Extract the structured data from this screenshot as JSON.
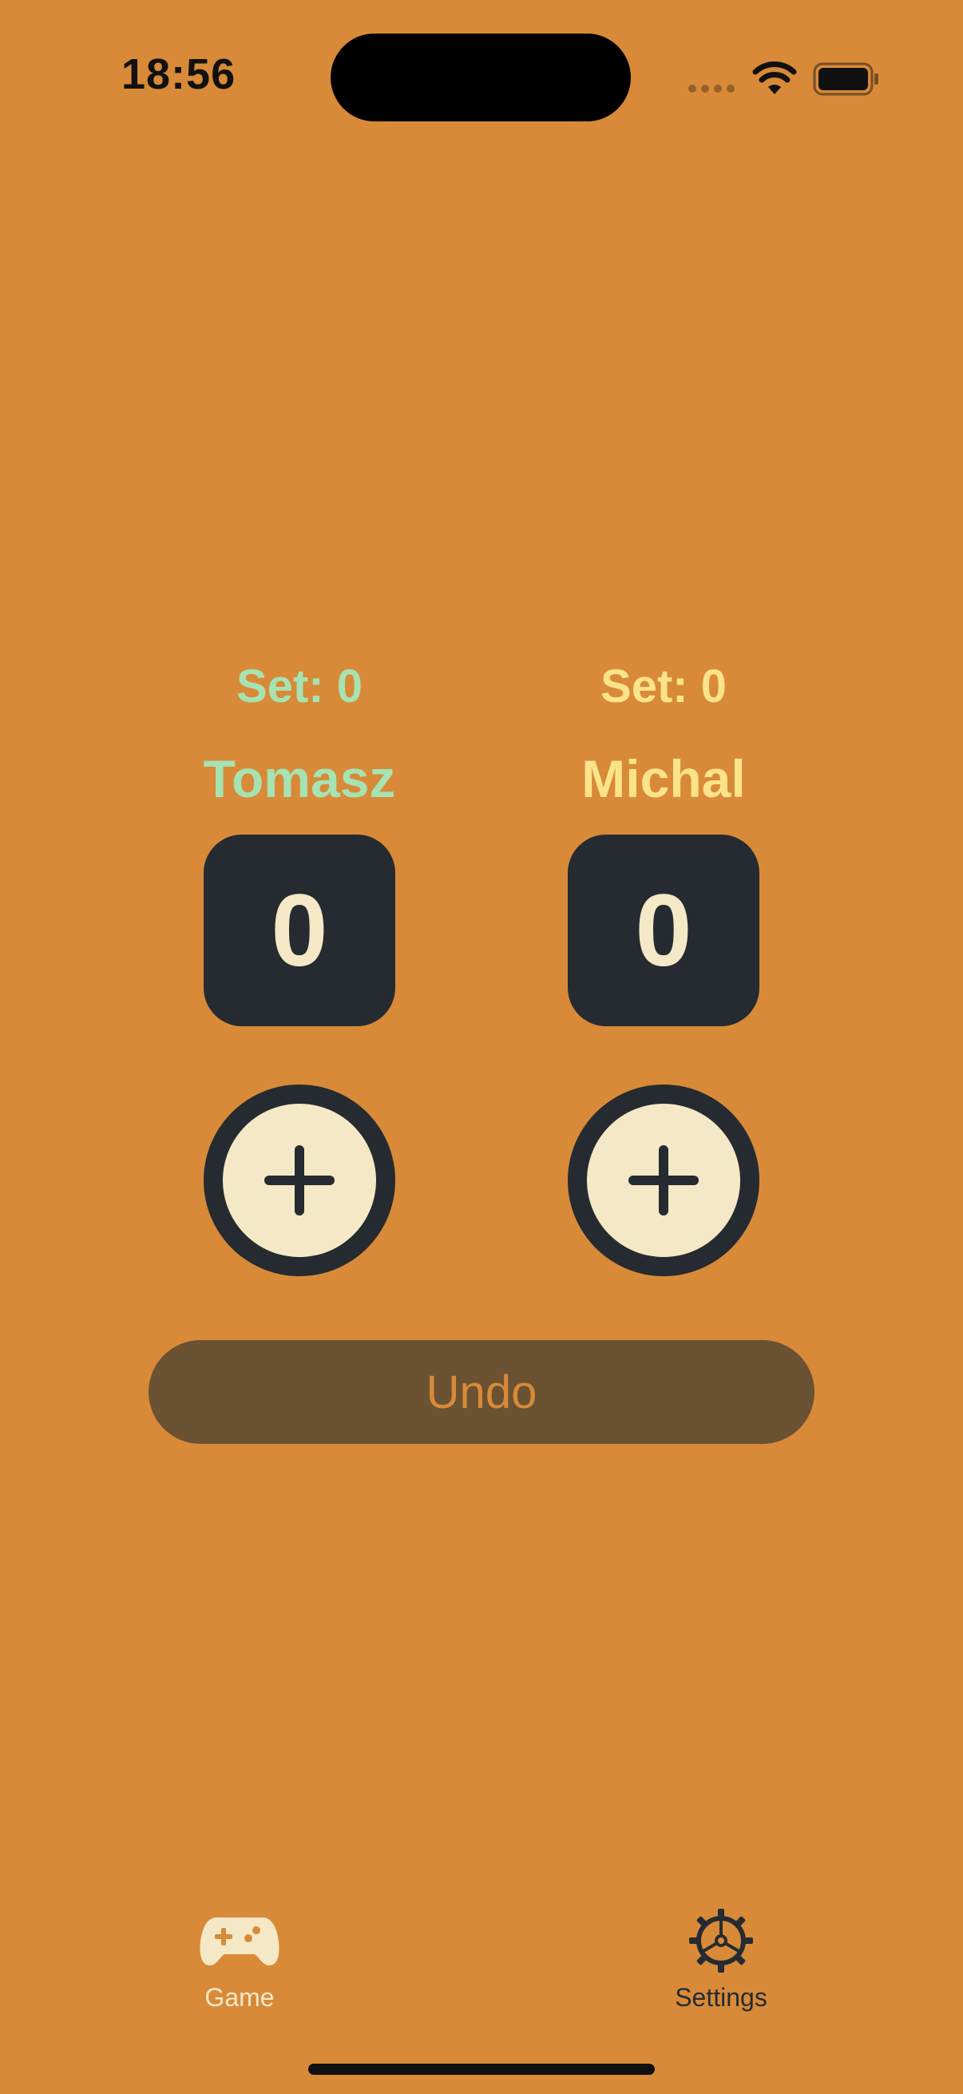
{
  "status_bar": {
    "time": "18:56"
  },
  "players": [
    {
      "set_label": "Set: 0",
      "name": "Tomasz",
      "score": "0",
      "color": "#A6E3B2"
    },
    {
      "set_label": "Set: 0",
      "name": "Michal",
      "score": "0",
      "color": "#FBE38A"
    }
  ],
  "undo_label": "Undo",
  "tab_bar": {
    "items": [
      {
        "label": "Game",
        "icon": "gamecontroller-icon",
        "active": true
      },
      {
        "label": "Settings",
        "icon": "gear-icon",
        "active": false
      }
    ]
  },
  "colors": {
    "background": "#D88A38",
    "dark": "#252B30",
    "cream": "#F5E8C6",
    "undo_bg": "#6A5233"
  }
}
